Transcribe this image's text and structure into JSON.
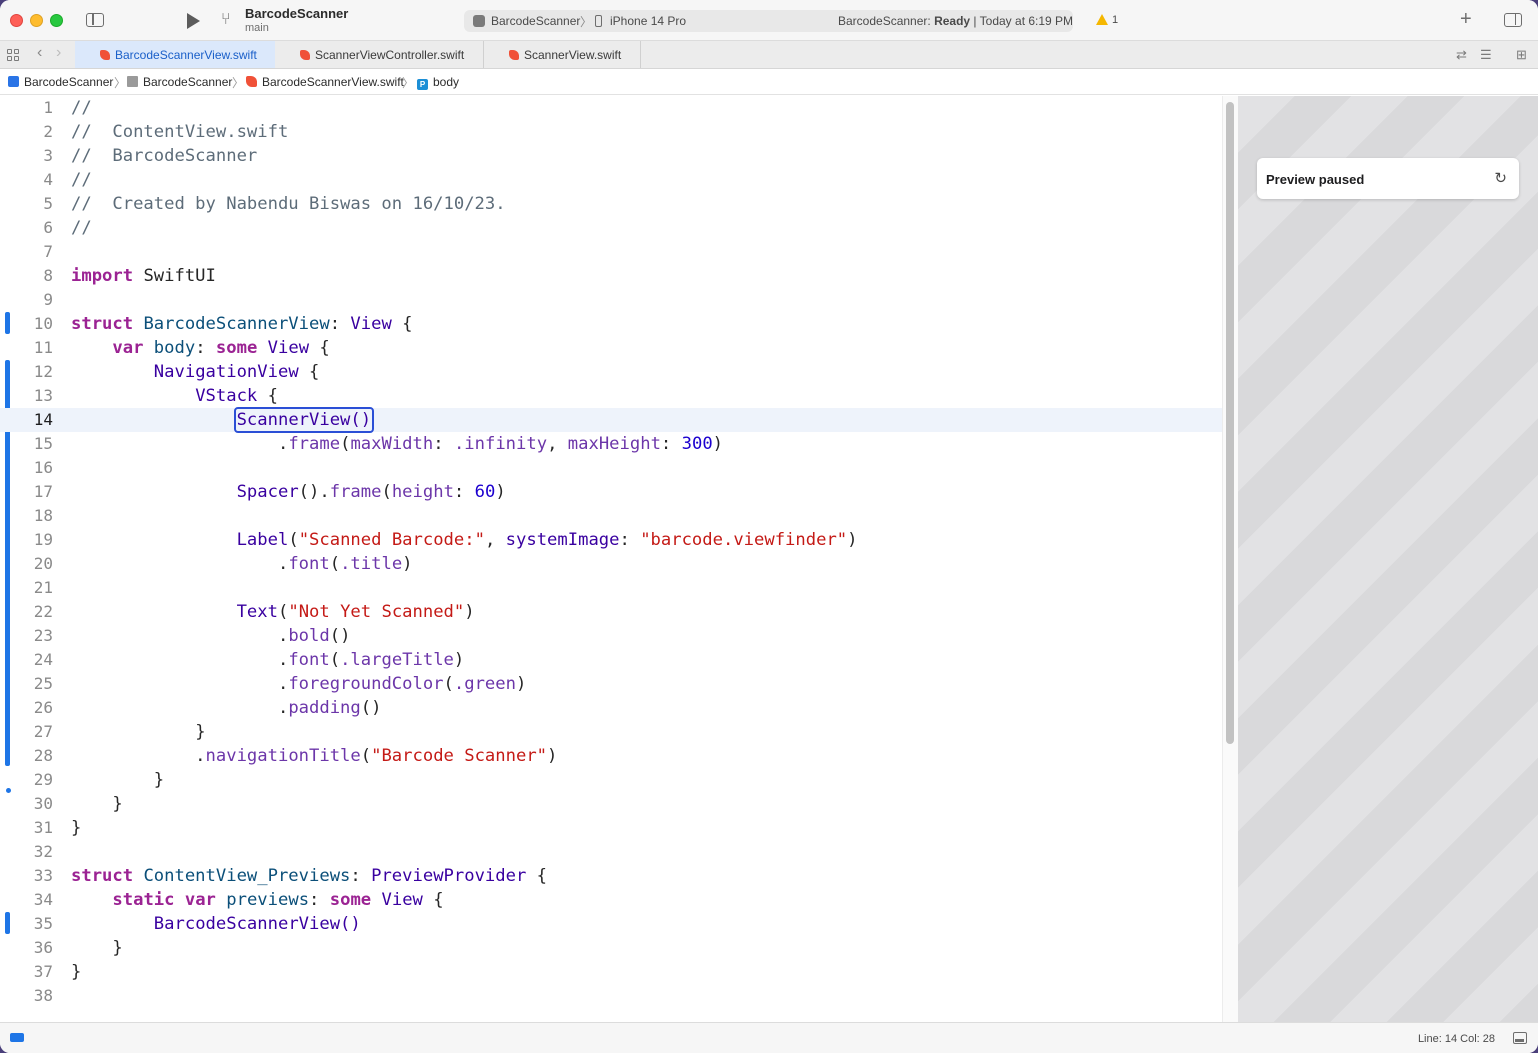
{
  "toolbar": {
    "project_name": "BarcodeScanner",
    "branch": "main",
    "scheme": "BarcodeScanner",
    "scheme_separator": "〉",
    "device": "iPhone 14 Pro",
    "status_prefix": "BarcodeScanner: ",
    "status_state": "Ready",
    "status_suffix": " | Today at 6:19 PM",
    "warning_count": "1",
    "add_label": "+"
  },
  "tabs": [
    {
      "label": "BarcodeScannerView.swift",
      "active": true
    },
    {
      "label": "ScannerViewController.swift",
      "active": false
    },
    {
      "label": "ScannerView.swift",
      "active": false
    }
  ],
  "jump_bar": [
    {
      "label": "BarcodeScanner",
      "icon": "app-icon"
    },
    {
      "label": "BarcodeScanner",
      "icon": "folder-icon"
    },
    {
      "label": "BarcodeScannerView.swift",
      "icon": "swift-file-icon"
    },
    {
      "label": "body",
      "icon": "property-icon"
    }
  ],
  "editor": {
    "current_line": 14,
    "lines": [
      {
        "n": "1"
      },
      {
        "n": "2"
      },
      {
        "n": "3"
      },
      {
        "n": "4"
      },
      {
        "n": "5"
      },
      {
        "n": "6"
      },
      {
        "n": "7"
      },
      {
        "n": "8"
      },
      {
        "n": "9"
      },
      {
        "n": "10"
      },
      {
        "n": "11"
      },
      {
        "n": "12"
      },
      {
        "n": "13"
      },
      {
        "n": "14"
      },
      {
        "n": "15"
      },
      {
        "n": "16"
      },
      {
        "n": "17"
      },
      {
        "n": "18"
      },
      {
        "n": "19"
      },
      {
        "n": "20"
      },
      {
        "n": "21"
      },
      {
        "n": "22"
      },
      {
        "n": "23"
      },
      {
        "n": "24"
      },
      {
        "n": "25"
      },
      {
        "n": "26"
      },
      {
        "n": "27"
      },
      {
        "n": "28"
      },
      {
        "n": "29"
      },
      {
        "n": "30"
      },
      {
        "n": "31"
      },
      {
        "n": "32"
      },
      {
        "n": "33"
      },
      {
        "n": "34"
      },
      {
        "n": "35"
      },
      {
        "n": "36"
      },
      {
        "n": "37"
      },
      {
        "n": "38"
      }
    ],
    "code": {
      "l1": "//",
      "l2": "//  ContentView.swift",
      "l3": "//  BarcodeScanner",
      "l4": "//",
      "l5": "//  Created by Nabendu Biswas on 16/10/23.",
      "l6": "//",
      "import_kw": "import",
      "import_mod": " SwiftUI",
      "struct_kw": "struct",
      "struct_name": " BarcodeScannerView",
      "colon": ": ",
      "view_type": "View",
      "open_brace": " {",
      "var_kw": "var",
      "body_name": " body",
      "some_kw": "some",
      "nav_view": "NavigationView",
      "vstack": "VStack",
      "scanner_view": "ScannerView()",
      "frame_dot": ".",
      "frame": "frame",
      "max_width": "maxWidth",
      "infinity": ".infinity",
      "max_height": "maxHeight",
      "num_300": "300",
      "spacer": "Spacer",
      "height": "height",
      "num_60": "60",
      "label": "Label",
      "scanned_str": "\"Scanned Barcode:\"",
      "system_image": "systemImage",
      "viewfinder_str": "\"barcode.viewfinder\"",
      "font": "font",
      "title": ".title",
      "text": "Text",
      "not_scanned_str": "\"Not Yet Scanned\"",
      "bold": "bold",
      "large_title": ".largeTitle",
      "fg_color": "foregroundColor",
      "green": ".green",
      "padding": "padding",
      "close_brace": "}",
      "nav_title": "navigationTitle",
      "nav_title_str": "\"Barcode Scanner\"",
      "preview_struct": " ContentView_Previews",
      "preview_provider": "PreviewProvider",
      "static_kw": "static",
      "previews_name": " previews",
      "barcode_scanner_call": "BarcodeScannerView()"
    }
  },
  "canvas": {
    "preview_status": "Preview paused"
  },
  "status_bar": {
    "cursor": "Line: 14  Col: 28"
  },
  "colors": {
    "keyword": "#9b2393",
    "type": "#3900a0",
    "string": "#c41a16",
    "number": "#1c00cf",
    "comment": "#5d6c79",
    "accent": "#1e75e6"
  }
}
